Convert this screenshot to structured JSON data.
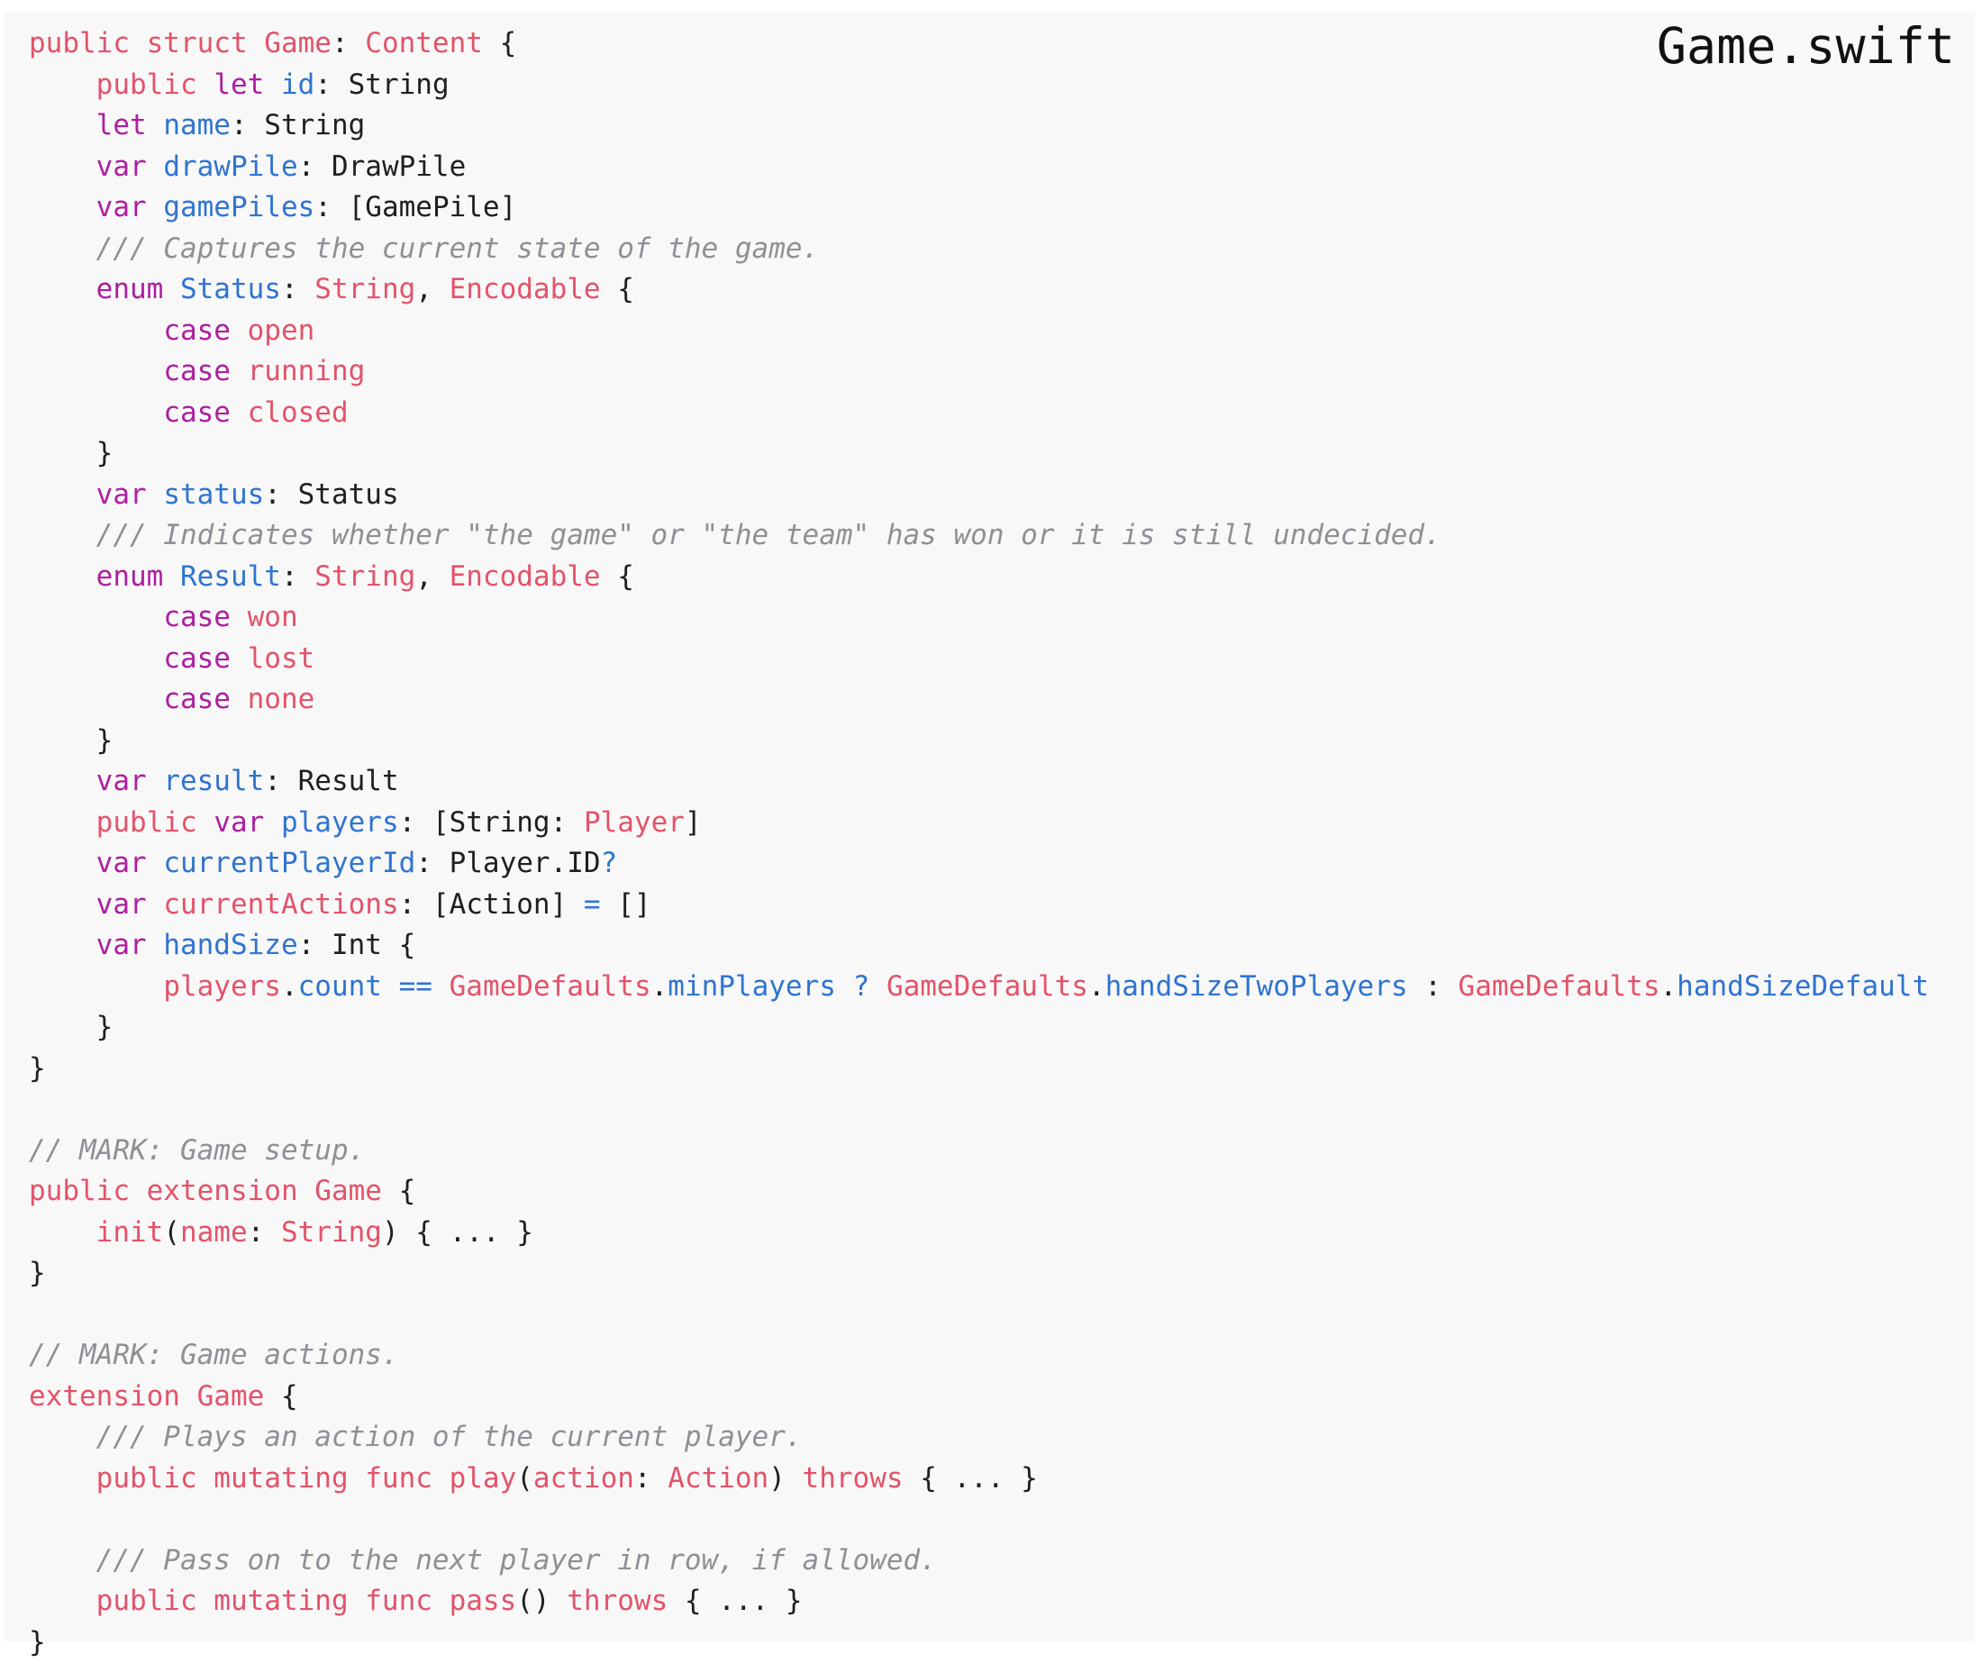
{
  "file": {
    "name": "Game.swift"
  },
  "colors": {
    "background": "#f8f8f8",
    "keyword": "#ad1fa0",
    "type": "#e3536a",
    "identifier": "#2f74d0",
    "comment": "#8f9096",
    "plain": "#1f1f1f"
  },
  "code": {
    "lines": [
      [
        [
          "kw2",
          "public struct "
        ],
        [
          "type",
          "Game"
        ],
        [
          "plain",
          ": "
        ],
        [
          "type",
          "Content"
        ],
        [
          "plain",
          " {"
        ]
      ],
      [
        [
          "plain",
          "    "
        ],
        [
          "kw2",
          "public "
        ],
        [
          "kw",
          "let "
        ],
        [
          "id",
          "id"
        ],
        [
          "plain",
          ": String"
        ]
      ],
      [
        [
          "plain",
          "    "
        ],
        [
          "kw",
          "let "
        ],
        [
          "id",
          "name"
        ],
        [
          "plain",
          ": String"
        ]
      ],
      [
        [
          "plain",
          "    "
        ],
        [
          "kw",
          "var "
        ],
        [
          "id",
          "drawPile"
        ],
        [
          "plain",
          ": DrawPile"
        ]
      ],
      [
        [
          "plain",
          "    "
        ],
        [
          "kw",
          "var "
        ],
        [
          "id",
          "gamePiles"
        ],
        [
          "plain",
          ": [GamePile]"
        ]
      ],
      [
        [
          "plain",
          "    "
        ],
        [
          "comment",
          "/// Captures the current state of the game."
        ]
      ],
      [
        [
          "plain",
          "    "
        ],
        [
          "kw",
          "enum "
        ],
        [
          "id",
          "Status"
        ],
        [
          "plain",
          ": "
        ],
        [
          "type",
          "String"
        ],
        [
          "plain",
          ", "
        ],
        [
          "type",
          "Encodable"
        ],
        [
          "plain",
          " {"
        ]
      ],
      [
        [
          "plain",
          "        "
        ],
        [
          "kw",
          "case "
        ],
        [
          "case",
          "open"
        ]
      ],
      [
        [
          "plain",
          "        "
        ],
        [
          "kw",
          "case "
        ],
        [
          "case",
          "running"
        ]
      ],
      [
        [
          "plain",
          "        "
        ],
        [
          "kw",
          "case "
        ],
        [
          "case",
          "closed"
        ]
      ],
      [
        [
          "plain",
          "    }"
        ]
      ],
      [
        [
          "plain",
          "    "
        ],
        [
          "kw",
          "var "
        ],
        [
          "id",
          "status"
        ],
        [
          "plain",
          ": Status"
        ]
      ],
      [
        [
          "plain",
          "    "
        ],
        [
          "comment",
          "/// Indicates whether \"the game\" or \"the team\" has won or it is still undecided."
        ]
      ],
      [
        [
          "plain",
          "    "
        ],
        [
          "kw",
          "enum "
        ],
        [
          "id",
          "Result"
        ],
        [
          "plain",
          ": "
        ],
        [
          "type",
          "String"
        ],
        [
          "plain",
          ", "
        ],
        [
          "type",
          "Encodable"
        ],
        [
          "plain",
          " {"
        ]
      ],
      [
        [
          "plain",
          "        "
        ],
        [
          "kw",
          "case "
        ],
        [
          "case",
          "won"
        ]
      ],
      [
        [
          "plain",
          "        "
        ],
        [
          "kw",
          "case "
        ],
        [
          "case",
          "lost"
        ]
      ],
      [
        [
          "plain",
          "        "
        ],
        [
          "kw",
          "case "
        ],
        [
          "case",
          "none"
        ]
      ],
      [
        [
          "plain",
          "    }"
        ]
      ],
      [
        [
          "plain",
          "    "
        ],
        [
          "kw",
          "var "
        ],
        [
          "id",
          "result"
        ],
        [
          "plain",
          ": Result"
        ]
      ],
      [
        [
          "plain",
          "    "
        ],
        [
          "kw2",
          "public "
        ],
        [
          "kw",
          "var "
        ],
        [
          "id",
          "players"
        ],
        [
          "plain",
          ": [String: "
        ],
        [
          "type",
          "Player"
        ],
        [
          "plain",
          "]"
        ]
      ],
      [
        [
          "plain",
          "    "
        ],
        [
          "kw",
          "var "
        ],
        [
          "id",
          "currentPlayerId"
        ],
        [
          "plain",
          ": Player.ID"
        ],
        [
          "op",
          "?"
        ]
      ],
      [
        [
          "plain",
          "    "
        ],
        [
          "kw",
          "var "
        ],
        [
          "type",
          "currentActions"
        ],
        [
          "plain",
          ": [Action] "
        ],
        [
          "op",
          "="
        ],
        [
          "plain",
          " []"
        ]
      ],
      [
        [
          "plain",
          "    "
        ],
        [
          "kw",
          "var "
        ],
        [
          "id",
          "handSize"
        ],
        [
          "plain",
          ": Int {"
        ]
      ],
      [
        [
          "plain",
          "        "
        ],
        [
          "type",
          "players"
        ],
        [
          "plain",
          "."
        ],
        [
          "prop",
          "count"
        ],
        [
          "plain",
          " "
        ],
        [
          "op",
          "=="
        ],
        [
          "plain",
          " "
        ],
        [
          "type",
          "GameDefaults"
        ],
        [
          "plain",
          "."
        ],
        [
          "prop",
          "minPlayers"
        ],
        [
          "plain",
          " "
        ],
        [
          "op",
          "?"
        ],
        [
          "plain",
          " "
        ],
        [
          "type",
          "GameDefaults"
        ],
        [
          "plain",
          "."
        ],
        [
          "prop",
          "handSizeTwoPlayers"
        ],
        [
          "plain",
          " : "
        ],
        [
          "type",
          "GameDefaults"
        ],
        [
          "plain",
          "."
        ],
        [
          "prop",
          "handSizeDefault"
        ]
      ],
      [
        [
          "plain",
          "    }"
        ]
      ],
      [
        [
          "plain",
          "}"
        ]
      ],
      [
        [
          "plain",
          ""
        ]
      ],
      [
        [
          "comment",
          "// MARK: Game setup."
        ]
      ],
      [
        [
          "kw2",
          "public extension "
        ],
        [
          "type",
          "Game"
        ],
        [
          "plain",
          " {"
        ]
      ],
      [
        [
          "plain",
          "    "
        ],
        [
          "kw2",
          "init"
        ],
        [
          "plain",
          "("
        ],
        [
          "type",
          "name"
        ],
        [
          "plain",
          ": "
        ],
        [
          "type",
          "String"
        ],
        [
          "plain",
          ") { ... }"
        ]
      ],
      [
        [
          "plain",
          "}"
        ]
      ],
      [
        [
          "plain",
          ""
        ]
      ],
      [
        [
          "comment",
          "// MARK: Game actions."
        ]
      ],
      [
        [
          "kw2",
          "extension "
        ],
        [
          "type",
          "Game"
        ],
        [
          "plain",
          " {"
        ]
      ],
      [
        [
          "plain",
          "    "
        ],
        [
          "comment",
          "/// Plays an action of the current player."
        ]
      ],
      [
        [
          "plain",
          "    "
        ],
        [
          "kw2",
          "public mutating func "
        ],
        [
          "type",
          "play"
        ],
        [
          "plain",
          "("
        ],
        [
          "type",
          "action"
        ],
        [
          "plain",
          ": "
        ],
        [
          "type",
          "Action"
        ],
        [
          "plain",
          ") "
        ],
        [
          "kw2",
          "throws"
        ],
        [
          "plain",
          " { ... }"
        ]
      ],
      [
        [
          "plain",
          ""
        ]
      ],
      [
        [
          "plain",
          "    "
        ],
        [
          "comment",
          "/// Pass on to the next player in row, if allowed."
        ]
      ],
      [
        [
          "plain",
          "    "
        ],
        [
          "kw2",
          "public mutating func "
        ],
        [
          "type",
          "pass"
        ],
        [
          "plain",
          "() "
        ],
        [
          "kw2",
          "throws"
        ],
        [
          "plain",
          " { ... }"
        ]
      ],
      [
        [
          "plain",
          "}"
        ]
      ]
    ]
  }
}
